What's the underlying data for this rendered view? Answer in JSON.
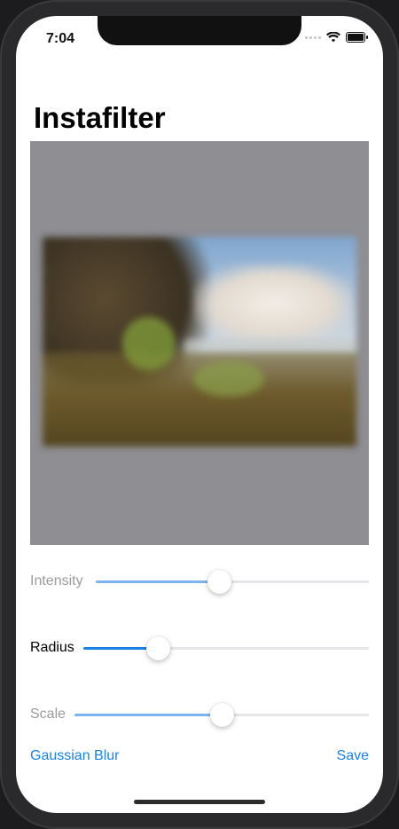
{
  "status_bar": {
    "time": "7:04"
  },
  "nav": {
    "title": "Instafilter"
  },
  "controls": {
    "intensity": {
      "label": "Intensity",
      "value": 0.45,
      "enabled": false
    },
    "radius": {
      "label": "Radius",
      "value": 0.26,
      "enabled": true
    },
    "scale": {
      "label": "Scale",
      "value": 0.5,
      "enabled": false
    }
  },
  "toolbar": {
    "filter_label": "Gaussian Blur",
    "save_label": "Save"
  },
  "colors": {
    "accent": "#1a82e2",
    "canvas_bg": "#8e8e93"
  },
  "icons": [
    "signal-icon",
    "wifi-icon",
    "battery-icon"
  ]
}
